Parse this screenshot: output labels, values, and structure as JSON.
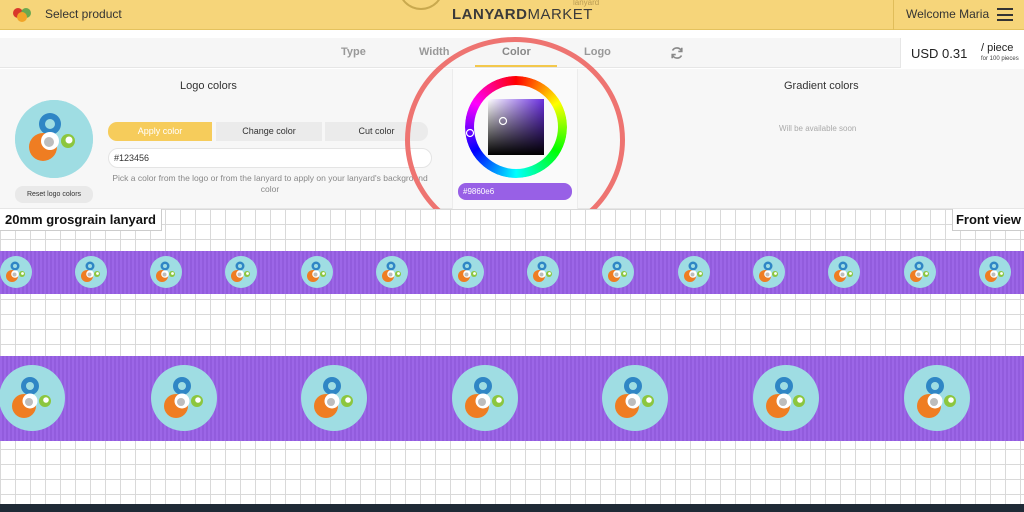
{
  "topbar": {
    "select_product": "Select product",
    "logo_bold": "LANYARD",
    "logo_rest": "MARKET",
    "logo_sub": "lanyard",
    "welcome": "Welcome Maria"
  },
  "tabs": [
    {
      "label": "Type"
    },
    {
      "label": "Width"
    },
    {
      "label": "Color"
    },
    {
      "label": "Logo"
    }
  ],
  "active_tab": "Color",
  "price": {
    "amount": "USD 0.31",
    "unit": "/ piece",
    "note": "for 100 pieces"
  },
  "logo_colors": {
    "title": "Logo colors",
    "reset_label": "Reset logo colors",
    "apply_label": "Apply color",
    "change_label": "Change color",
    "cut_label": "Cut color",
    "hex_value": "#123456",
    "hint": "Pick a color from the logo or from the lanyard to apply on your lanyard's background color"
  },
  "color_picker": {
    "hex": "#9860e6"
  },
  "gradient": {
    "title": "Gradient colors",
    "note": "Will be available soon"
  },
  "preview": {
    "type_label": "20mm grosgrain lanyard",
    "view_label": "Front view"
  },
  "colors": {
    "lanyard": "#9860e6",
    "accent": "#f6d57a",
    "highlight": "#ee7471"
  }
}
